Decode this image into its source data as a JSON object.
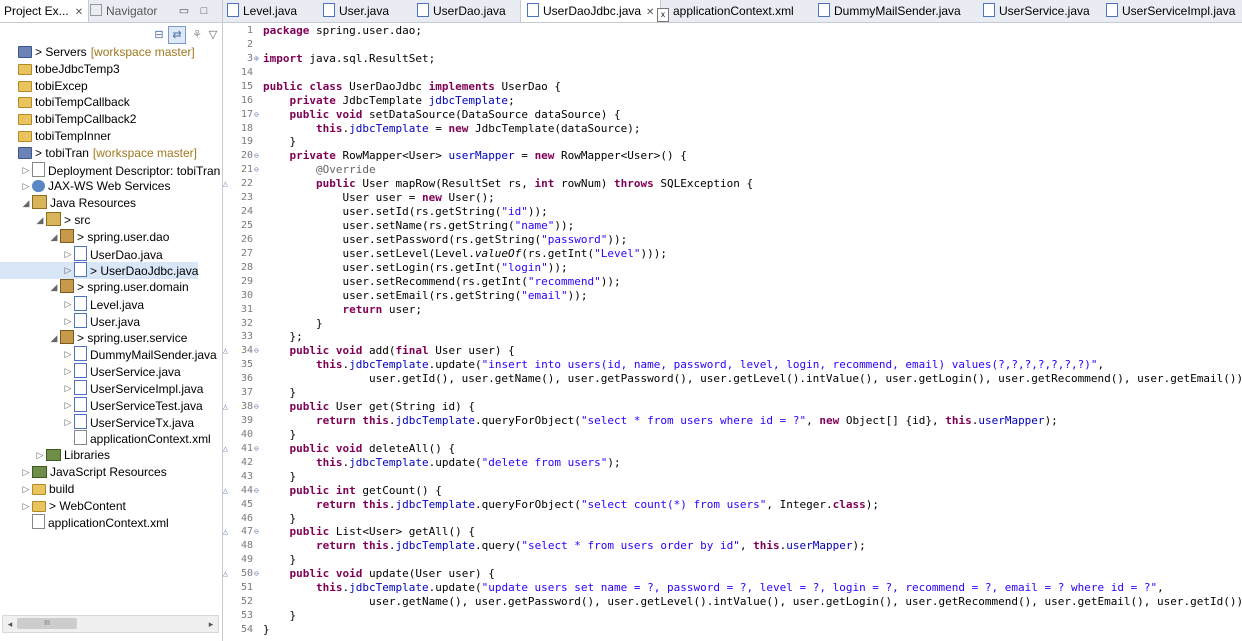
{
  "left_panel": {
    "tabs": [
      {
        "label": "Project Ex...",
        "close": "✕",
        "icon": "project-explorer-icon"
      },
      {
        "label": "Navigator",
        "icon": "navigator-icon"
      }
    ],
    "tree": [
      {
        "label": "> Servers",
        "suffix": "[workspace master]",
        "icon": "server-project-icon",
        "indent": 0,
        "toggle": ""
      },
      {
        "label": "tobeJdbcTemp3",
        "icon": "folder-icon",
        "indent": 0,
        "toggle": ""
      },
      {
        "label": "tobiExcep",
        "icon": "folder-icon",
        "indent": 0,
        "toggle": ""
      },
      {
        "label": "tobiTempCallback",
        "icon": "folder-icon",
        "indent": 0,
        "toggle": ""
      },
      {
        "label": "tobiTempCallback2",
        "icon": "folder-icon",
        "indent": 0,
        "toggle": ""
      },
      {
        "label": "tobiTempInner",
        "icon": "folder-icon",
        "indent": 0,
        "toggle": ""
      },
      {
        "label": "> tobiTran",
        "suffix": "[workspace master]",
        "icon": "web-project-icon",
        "indent": 0,
        "toggle": ""
      },
      {
        "label": "Deployment Descriptor: tobiTran",
        "icon": "deployment-descriptor-icon",
        "indent": 1,
        "toggle": "▷"
      },
      {
        "label": "JAX-WS Web Services",
        "icon": "web-services-icon",
        "indent": 1,
        "toggle": "▷"
      },
      {
        "label": "Java Resources",
        "icon": "java-resources-icon",
        "indent": 1,
        "toggle": "◢"
      },
      {
        "label": "> src",
        "icon": "source-folder-icon",
        "indent": 2,
        "toggle": "◢"
      },
      {
        "label": "> spring.user.dao",
        "icon": "package-icon",
        "indent": 3,
        "toggle": "◢"
      },
      {
        "label": "UserDao.java",
        "icon": "java-file-icon",
        "indent": 4,
        "toggle": "▷"
      },
      {
        "label": "> UserDaoJdbc.java",
        "icon": "java-file-icon",
        "indent": 4,
        "toggle": "▷",
        "selected": true
      },
      {
        "label": "> spring.user.domain",
        "icon": "package-icon",
        "indent": 3,
        "toggle": "◢"
      },
      {
        "label": "Level.java",
        "icon": "java-file-icon",
        "indent": 4,
        "toggle": "▷"
      },
      {
        "label": "User.java",
        "icon": "java-file-icon",
        "indent": 4,
        "toggle": "▷"
      },
      {
        "label": "> spring.user.service",
        "icon": "package-icon",
        "indent": 3,
        "toggle": "◢"
      },
      {
        "label": "DummyMailSender.java",
        "icon": "java-file-icon",
        "indent": 4,
        "toggle": "▷"
      },
      {
        "label": "UserService.java",
        "icon": "java-file-icon",
        "indent": 4,
        "toggle": "▷"
      },
      {
        "label": "UserServiceImpl.java",
        "icon": "java-file-icon",
        "indent": 4,
        "toggle": "▷"
      },
      {
        "label": "UserServiceTest.java",
        "icon": "java-file-icon",
        "indent": 4,
        "toggle": "▷"
      },
      {
        "label": "UserServiceTx.java",
        "icon": "java-file-icon",
        "indent": 4,
        "toggle": "▷"
      },
      {
        "label": "applicationContext.xml",
        "icon": "xml-file-icon",
        "indent": 4,
        "toggle": ""
      },
      {
        "label": "Libraries",
        "icon": "libraries-icon",
        "indent": 2,
        "toggle": "▷"
      },
      {
        "label": "JavaScript Resources",
        "icon": "javascript-resources-icon",
        "indent": 1,
        "toggle": "▷"
      },
      {
        "label": "build",
        "icon": "folder-icon",
        "indent": 1,
        "toggle": "▷"
      },
      {
        "label": "> WebContent",
        "icon": "web-content-icon",
        "indent": 1,
        "toggle": "▷"
      },
      {
        "label": "applicationContext.xml",
        "icon": "xml-file-icon",
        "indent": 1,
        "toggle": ""
      }
    ],
    "scroll_label": "III"
  },
  "editor": {
    "tabs": [
      {
        "label": "Level.java",
        "icon": "java-file-icon"
      },
      {
        "label": "User.java",
        "icon": "java-file-icon"
      },
      {
        "label": "UserDao.java",
        "icon": "java-file-icon"
      },
      {
        "label": "UserDaoJdbc.java",
        "icon": "java-file-icon",
        "active": true,
        "close": "✕"
      },
      {
        "label": "applicationContext.xml",
        "icon": "xml-file-icon"
      },
      {
        "label": "DummyMailSender.java",
        "icon": "java-file-icon"
      },
      {
        "label": "UserService.java",
        "icon": "java-file-icon"
      },
      {
        "label": "UserServiceImpl.java",
        "icon": "java-file-icon"
      }
    ],
    "lines": [
      {
        "n": "1",
        "t": "package spring.user.dao;"
      },
      {
        "n": "2",
        "t": ""
      },
      {
        "n": "3",
        "t": "import java.sql.ResultSet;",
        "fold": "⊕"
      },
      {
        "n": "14",
        "t": ""
      },
      {
        "n": "15",
        "t": "public class UserDaoJdbc implements UserDao {"
      },
      {
        "n": "16",
        "t": "    private JdbcTemplate jdbcTemplate;"
      },
      {
        "n": "17",
        "t": "    public void setDataSource(DataSource dataSource) {",
        "fold": "⊖"
      },
      {
        "n": "18",
        "t": "        this.jdbcTemplate = new JdbcTemplate(dataSource);"
      },
      {
        "n": "19",
        "t": "    }"
      },
      {
        "n": "20",
        "t": "    private RowMapper<User> userMapper = new RowMapper<User>() {",
        "fold": "⊖"
      },
      {
        "n": "21",
        "t": "        @Override",
        "fold": "⊖"
      },
      {
        "n": "22",
        "t": "        public User mapRow(ResultSet rs, int rowNum) throws SQLException {",
        "mark": "△"
      },
      {
        "n": "23",
        "t": "            User user = new User();"
      },
      {
        "n": "24",
        "t": "            user.setId(rs.getString(\"id\"));"
      },
      {
        "n": "25",
        "t": "            user.setName(rs.getString(\"name\"));"
      },
      {
        "n": "26",
        "t": "            user.setPassword(rs.getString(\"password\"));"
      },
      {
        "n": "27",
        "t": "            user.setLevel(Level.valueOf(rs.getInt(\"Level\")));"
      },
      {
        "n": "28",
        "t": "            user.setLogin(rs.getInt(\"login\"));"
      },
      {
        "n": "29",
        "t": "            user.setRecommend(rs.getInt(\"recommend\"));"
      },
      {
        "n": "30",
        "t": "            user.setEmail(rs.getString(\"email\"));"
      },
      {
        "n": "31",
        "t": "            return user;"
      },
      {
        "n": "32",
        "t": "        }"
      },
      {
        "n": "33",
        "t": "    };"
      },
      {
        "n": "34",
        "t": "    public void add(final User user) {",
        "fold": "⊖",
        "mark": "△"
      },
      {
        "n": "35",
        "t": "        this.jdbcTemplate.update(\"insert into users(id, name, password, level, login, recommend, email) values(?,?,?,?,?,?,?)\","
      },
      {
        "n": "36",
        "t": "                user.getId(), user.getName(), user.getPassword(), user.getLevel().intValue(), user.getLogin(), user.getRecommend(), user.getEmail());"
      },
      {
        "n": "37",
        "t": "    }"
      },
      {
        "n": "38",
        "t": "    public User get(String id) {",
        "fold": "⊖",
        "mark": "△"
      },
      {
        "n": "39",
        "t": "        return this.jdbcTemplate.queryForObject(\"select * from users where id = ?\", new Object[] {id}, this.userMapper);"
      },
      {
        "n": "40",
        "t": "    }"
      },
      {
        "n": "41",
        "t": "    public void deleteAll() {",
        "fold": "⊖",
        "mark": "△"
      },
      {
        "n": "42",
        "t": "        this.jdbcTemplate.update(\"delete from users\");"
      },
      {
        "n": "43",
        "t": "    }"
      },
      {
        "n": "44",
        "t": "    public int getCount() {",
        "fold": "⊖",
        "mark": "△"
      },
      {
        "n": "45",
        "t": "        return this.jdbcTemplate.queryForObject(\"select count(*) from users\", Integer.class);"
      },
      {
        "n": "46",
        "t": "    }"
      },
      {
        "n": "47",
        "t": "    public List<User> getAll() {",
        "fold": "⊖",
        "mark": "△"
      },
      {
        "n": "48",
        "t": "        return this.jdbcTemplate.query(\"select * from users order by id\", this.userMapper);"
      },
      {
        "n": "49",
        "t": "    }"
      },
      {
        "n": "50",
        "t": "    public void update(User user) {",
        "fold": "⊖",
        "mark": "△"
      },
      {
        "n": "51",
        "t": "        this.jdbcTemplate.update(\"update users set name = ?, password = ?, level = ?, login = ?, recommend = ?, email = ? where id = ?\","
      },
      {
        "n": "52",
        "t": "                user.getName(), user.getPassword(), user.getLevel().intValue(), user.getLogin(), user.getRecommend(), user.getEmail(), user.getId());"
      },
      {
        "n": "53",
        "t": "    }"
      },
      {
        "n": "54",
        "t": "}"
      }
    ]
  },
  "colors": {
    "keyword": "#7f0055",
    "string": "#2a00ff",
    "field": "#0000c0",
    "annotation": "#646464",
    "selection": "#d9e6f7"
  }
}
